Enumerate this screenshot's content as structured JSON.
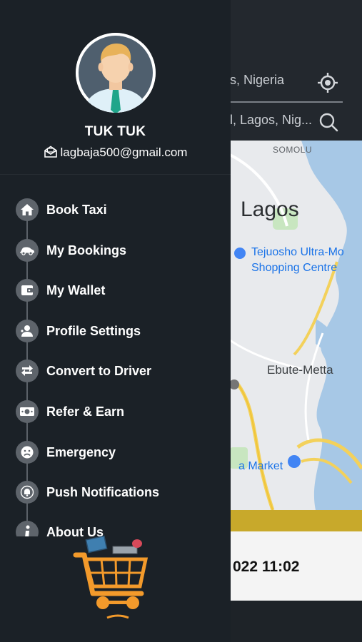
{
  "background_screen": {
    "pickup_text": "s, Nigeria",
    "dropoff_text": "l, Lagos, Nig...",
    "map": {
      "area_label_small": "SOMOLU",
      "city_label": "Lagos",
      "poi_1": "Tejuosho Ultra-Mo",
      "poi_1_line2": "Shopping Centre",
      "area_label_2": "Ebute-Metta",
      "poi_2": "a Market"
    },
    "booking_date": "022 11:02",
    "colors": {
      "map_water": "#a7c8e6",
      "map_land": "#e8eaed",
      "map_road": "#f3d15b",
      "accent_yellow": "#c8a92b"
    }
  },
  "drawer": {
    "user": {
      "name": "TUK TUK",
      "email": "lagbaja500@gmail.com"
    },
    "menu": [
      {
        "label": "Book Taxi",
        "icon": "home-icon"
      },
      {
        "label": "My Bookings",
        "icon": "car-icon"
      },
      {
        "label": "My Wallet",
        "icon": "wallet-icon"
      },
      {
        "label": "Profile Settings",
        "icon": "user-settings-icon"
      },
      {
        "label": "Convert to Driver",
        "icon": "swap-icon"
      },
      {
        "label": "Refer & Earn",
        "icon": "money-icon"
      },
      {
        "label": "Emergency",
        "icon": "emergency-face-icon"
      },
      {
        "label": "Push Notifications",
        "icon": "bell-icon"
      },
      {
        "label": "About Us",
        "icon": "info-icon"
      }
    ],
    "colors": {
      "drawer_bg": "#1b2127",
      "icon_circle": "#5e646b",
      "text": "#ffffff"
    }
  }
}
